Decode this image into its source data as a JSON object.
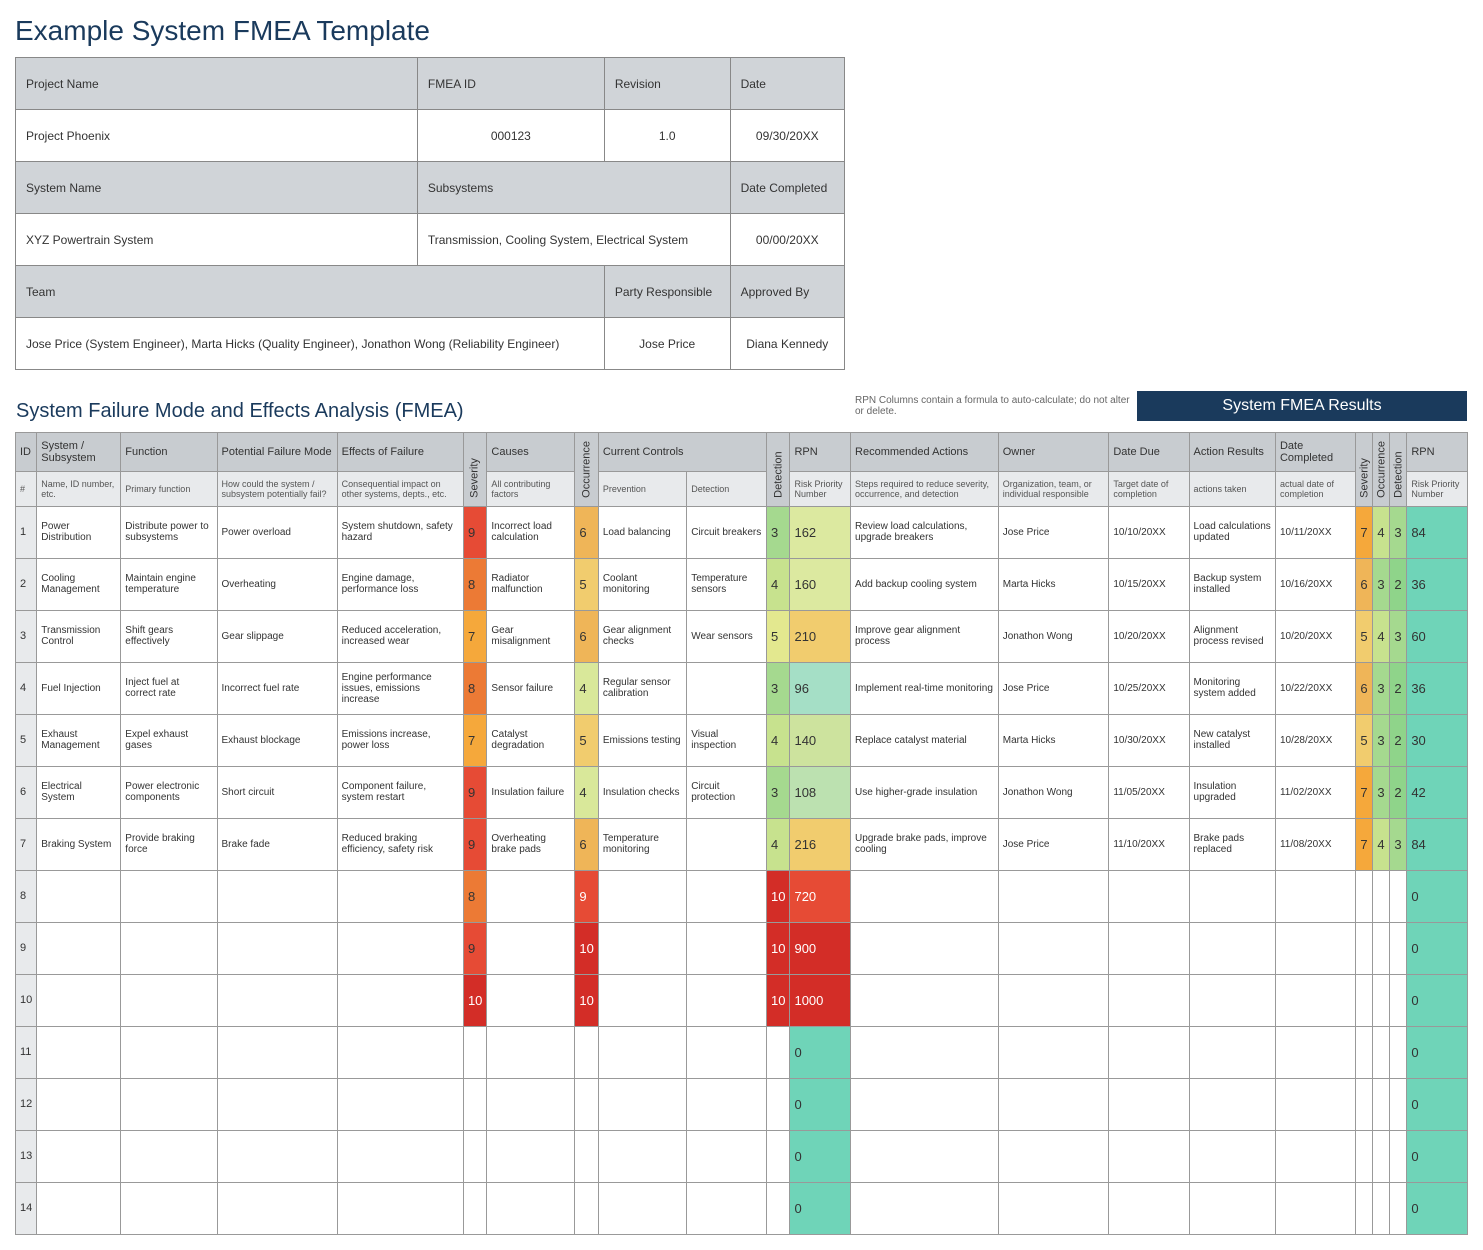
{
  "title": "Example System FMEA Template",
  "project": {
    "labels": {
      "project_name": "Project Name",
      "fmea_id": "FMEA ID",
      "revision": "Revision",
      "date": "Date",
      "system_name": "System Name",
      "subsystems": "Subsystems",
      "date_completed": "Date Completed",
      "team": "Team",
      "party_responsible": "Party Responsible",
      "approved_by": "Approved By"
    },
    "project_name": "Project Phoenix",
    "fmea_id": "000123",
    "revision": "1.0",
    "date": "09/30/20XX",
    "system_name": "XYZ Powertrain System",
    "subsystems": "Transmission, Cooling System, Electrical System",
    "date_completed": "00/00/20XX",
    "team": "Jose Price (System Engineer), Marta Hicks (Quality Engineer), Jonathon Wong (Reliability Engineer)",
    "party_responsible": "Jose Price",
    "approved_by": "Diana Kennedy"
  },
  "section_title": "System Failure Mode and Effects Analysis (FMEA)",
  "rpn_note": "RPN Columns contain a formula to auto-calculate; do not alter or delete.",
  "results_header": "System FMEA Results",
  "headers": {
    "top": [
      "ID",
      "System / Subsystem",
      "Function",
      "Potential Failure Mode",
      "Effects of Failure",
      "Severity",
      "Causes",
      "Occurrence",
      "Current Controls",
      "Detection",
      "RPN",
      "Recommended Actions",
      "Owner",
      "Date Due",
      "Action Results",
      "Date Completed",
      "Severity",
      "Occurrence",
      "Detection",
      "RPN"
    ],
    "sub": [
      "#",
      "Name, ID number, etc.",
      "Primary function",
      "How could the system / subsystem potentially fail?",
      "Consequential impact on other systems, depts., etc.",
      "",
      "All contributing factors",
      "",
      "Prevention",
      "Detection",
      "",
      "Risk Priority Number",
      "Steps required to reduce severity, occurrence, and detection",
      "Organization, team, or individual responsible",
      "Target date of completion",
      "actions taken",
      "actual date of completion",
      "",
      "",
      "",
      "Risk Priority Number"
    ]
  },
  "rows": [
    {
      "id": "1",
      "system": "Power Distribution",
      "function": "Distribute power to subsystems",
      "failure": "Power overload",
      "effects": "System shutdown, safety hazard",
      "sev": "9",
      "causes": "Incorrect load calculation",
      "occ": "6",
      "prevention": "Load balancing",
      "detection": "Circuit breakers",
      "det": "3",
      "rpn": "162",
      "rec": "Review load calculations, upgrade breakers",
      "owner": "Jose Price",
      "due": "10/10/20XX",
      "action": "Load calculations updated",
      "completed": "10/11/20XX",
      "rsev": "7",
      "rocc": "4",
      "rdet": "3",
      "rrpn": "84"
    },
    {
      "id": "2",
      "system": "Cooling Management",
      "function": "Maintain engine temperature",
      "failure": "Overheating",
      "effects": "Engine damage, performance loss",
      "sev": "8",
      "causes": "Radiator malfunction",
      "occ": "5",
      "prevention": "Coolant monitoring",
      "detection": "Temperature sensors",
      "det": "4",
      "rpn": "160",
      "rec": "Add backup cooling system",
      "owner": "Marta Hicks",
      "due": "10/15/20XX",
      "action": "Backup system installed",
      "completed": "10/16/20XX",
      "rsev": "6",
      "rocc": "3",
      "rdet": "2",
      "rrpn": "36"
    },
    {
      "id": "3",
      "system": "Transmission Control",
      "function": "Shift gears effectively",
      "failure": "Gear slippage",
      "effects": "Reduced acceleration, increased wear",
      "sev": "7",
      "causes": "Gear misalignment",
      "occ": "6",
      "prevention": "Gear alignment checks",
      "detection": "Wear sensors",
      "det": "5",
      "rpn": "210",
      "rec": "Improve gear alignment process",
      "owner": "Jonathon Wong",
      "due": "10/20/20XX",
      "action": "Alignment process revised",
      "completed": "10/20/20XX",
      "rsev": "5",
      "rocc": "4",
      "rdet": "3",
      "rrpn": "60"
    },
    {
      "id": "4",
      "system": "Fuel Injection",
      "function": "Inject fuel at correct rate",
      "failure": "Incorrect fuel rate",
      "effects": "Engine performance issues, emissions increase",
      "sev": "8",
      "causes": "Sensor failure",
      "occ": "4",
      "prevention": "Regular sensor calibration",
      "detection": "",
      "det": "3",
      "rpn": "96",
      "rec": "Implement real-time monitoring",
      "owner": "Jose Price",
      "due": "10/25/20XX",
      "action": "Monitoring system added",
      "completed": "10/22/20XX",
      "rsev": "6",
      "rocc": "3",
      "rdet": "2",
      "rrpn": "36"
    },
    {
      "id": "5",
      "system": "Exhaust Management",
      "function": "Expel exhaust gases",
      "failure": "Exhaust blockage",
      "effects": "Emissions increase, power loss",
      "sev": "7",
      "causes": "Catalyst degradation",
      "occ": "5",
      "prevention": "Emissions testing",
      "detection": "Visual inspection",
      "det": "4",
      "rpn": "140",
      "rec": "Replace catalyst material",
      "owner": "Marta Hicks",
      "due": "10/30/20XX",
      "action": "New catalyst installed",
      "completed": "10/28/20XX",
      "rsev": "5",
      "rocc": "3",
      "rdet": "2",
      "rrpn": "30"
    },
    {
      "id": "6",
      "system": "Electrical System",
      "function": "Power electronic components",
      "failure": "Short circuit",
      "effects": "Component failure, system restart",
      "sev": "9",
      "causes": "Insulation failure",
      "occ": "4",
      "prevention": "Insulation checks",
      "detection": "Circuit protection",
      "det": "3",
      "rpn": "108",
      "rec": "Use higher-grade insulation",
      "owner": "Jonathon Wong",
      "due": "11/05/20XX",
      "action": "Insulation upgraded",
      "completed": "11/02/20XX",
      "rsev": "7",
      "rocc": "3",
      "rdet": "2",
      "rrpn": "42"
    },
    {
      "id": "7",
      "system": "Braking System",
      "function": "Provide braking force",
      "failure": "Brake fade",
      "effects": "Reduced braking efficiency, safety risk",
      "sev": "9",
      "causes": "Overheating brake pads",
      "occ": "6",
      "prevention": "Temperature monitoring",
      "detection": "",
      "det": "4",
      "rpn": "216",
      "rec": "Upgrade brake pads, improve cooling",
      "owner": "Jose Price",
      "due": "11/10/20XX",
      "action": "Brake pads replaced",
      "completed": "11/08/20XX",
      "rsev": "7",
      "rocc": "4",
      "rdet": "3",
      "rrpn": "84"
    },
    {
      "id": "8",
      "system": "",
      "function": "",
      "failure": "",
      "effects": "",
      "sev": "8",
      "causes": "",
      "occ": "9",
      "prevention": "",
      "detection": "",
      "det": "10",
      "rpn": "720",
      "rec": "",
      "owner": "",
      "due": "",
      "action": "",
      "completed": "",
      "rsev": "",
      "rocc": "",
      "rdet": "",
      "rrpn": "0"
    },
    {
      "id": "9",
      "system": "",
      "function": "",
      "failure": "",
      "effects": "",
      "sev": "9",
      "causes": "",
      "occ": "10",
      "prevention": "",
      "detection": "",
      "det": "10",
      "rpn": "900",
      "rec": "",
      "owner": "",
      "due": "",
      "action": "",
      "completed": "",
      "rsev": "",
      "rocc": "",
      "rdet": "",
      "rrpn": "0"
    },
    {
      "id": "10",
      "system": "",
      "function": "",
      "failure": "",
      "effects": "",
      "sev": "10",
      "causes": "",
      "occ": "10",
      "prevention": "",
      "detection": "",
      "det": "10",
      "rpn": "1000",
      "rec": "",
      "owner": "",
      "due": "",
      "action": "",
      "completed": "",
      "rsev": "",
      "rocc": "",
      "rdet": "",
      "rrpn": "0"
    },
    {
      "id": "11",
      "system": "",
      "function": "",
      "failure": "",
      "effects": "",
      "sev": "",
      "causes": "",
      "occ": "",
      "prevention": "",
      "detection": "",
      "det": "",
      "rpn": "0",
      "rec": "",
      "owner": "",
      "due": "",
      "action": "",
      "completed": "",
      "rsev": "",
      "rocc": "",
      "rdet": "",
      "rrpn": "0"
    },
    {
      "id": "12",
      "system": "",
      "function": "",
      "failure": "",
      "effects": "",
      "sev": "",
      "causes": "",
      "occ": "",
      "prevention": "",
      "detection": "",
      "det": "",
      "rpn": "0",
      "rec": "",
      "owner": "",
      "due": "",
      "action": "",
      "completed": "",
      "rsev": "",
      "rocc": "",
      "rdet": "",
      "rrpn": "0"
    },
    {
      "id": "13",
      "system": "",
      "function": "",
      "failure": "",
      "effects": "",
      "sev": "",
      "causes": "",
      "occ": "",
      "prevention": "",
      "detection": "",
      "det": "",
      "rpn": "0",
      "rec": "",
      "owner": "",
      "due": "",
      "action": "",
      "completed": "",
      "rsev": "",
      "rocc": "",
      "rdet": "",
      "rrpn": "0"
    },
    {
      "id": "14",
      "system": "",
      "function": "",
      "failure": "",
      "effects": "",
      "sev": "",
      "causes": "",
      "occ": "",
      "prevention": "",
      "detection": "",
      "det": "",
      "rpn": "0",
      "rec": "",
      "owner": "",
      "due": "",
      "action": "",
      "completed": "",
      "rsev": "",
      "rocc": "",
      "rdet": "",
      "rrpn": "0"
    }
  ]
}
